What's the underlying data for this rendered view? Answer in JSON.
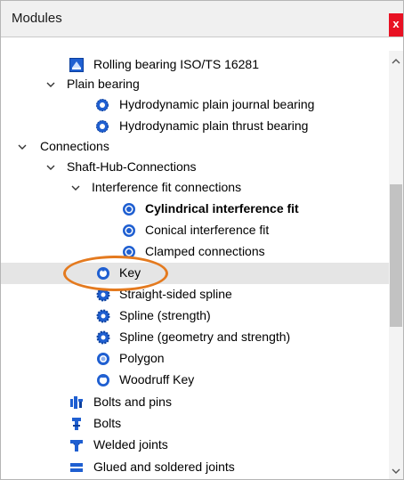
{
  "panel": {
    "title": "Modules",
    "close_label": "x"
  },
  "tree": {
    "items": [
      {
        "label": "Rolling bearing ISO/TS 16281",
        "icon": "rolling-bearing-icon",
        "expanded": null,
        "selected": false,
        "bold": false
      },
      {
        "label": "Plain bearing",
        "icon": null,
        "expanded": true,
        "selected": false,
        "bold": false
      },
      {
        "label": "Hydrodynamic plain journal bearing",
        "icon": "plain-bearing-icon",
        "expanded": null,
        "selected": false,
        "bold": false
      },
      {
        "label": "Hydrodynamic plain thrust bearing",
        "icon": "plain-bearing-icon",
        "expanded": null,
        "selected": false,
        "bold": false
      },
      {
        "label": "Connections",
        "icon": null,
        "expanded": true,
        "selected": false,
        "bold": false
      },
      {
        "label": "Shaft-Hub-Connections",
        "icon": null,
        "expanded": true,
        "selected": false,
        "bold": false
      },
      {
        "label": "Interference fit connections",
        "icon": null,
        "expanded": true,
        "selected": false,
        "bold": false
      },
      {
        "label": "Cylindrical interference fit",
        "icon": "interference-fit-icon",
        "expanded": null,
        "selected": false,
        "bold": true
      },
      {
        "label": "Conical interference fit",
        "icon": "interference-fit-icon",
        "expanded": null,
        "selected": false,
        "bold": false
      },
      {
        "label": "Clamped connections",
        "icon": "interference-fit-icon",
        "expanded": null,
        "selected": false,
        "bold": false
      },
      {
        "label": "Key",
        "icon": "key-icon",
        "expanded": null,
        "selected": true,
        "bold": false
      },
      {
        "label": "Straight-sided spline",
        "icon": "spline-icon",
        "expanded": null,
        "selected": false,
        "bold": false
      },
      {
        "label": "Spline (strength)",
        "icon": "spline-icon",
        "expanded": null,
        "selected": false,
        "bold": false
      },
      {
        "label": "Spline (geometry and strength)",
        "icon": "spline-icon",
        "expanded": null,
        "selected": false,
        "bold": false
      },
      {
        "label": "Polygon",
        "icon": "polygon-icon",
        "expanded": null,
        "selected": false,
        "bold": false
      },
      {
        "label": "Woodruff Key",
        "icon": "woodruff-key-icon",
        "expanded": null,
        "selected": false,
        "bold": false
      },
      {
        "label": "Bolts and pins",
        "icon": "bolts-pins-icon",
        "expanded": null,
        "selected": false,
        "bold": false
      },
      {
        "label": "Bolts",
        "icon": "bolt-icon",
        "expanded": null,
        "selected": false,
        "bold": false
      },
      {
        "label": "Welded joints",
        "icon": "welded-joint-icon",
        "expanded": null,
        "selected": false,
        "bold": false
      },
      {
        "label": "Glued and soldered joints",
        "icon": "glued-joint-icon",
        "expanded": null,
        "selected": false,
        "bold": false
      }
    ]
  },
  "colors": {
    "highlight_ring": "#e47a1f",
    "selection": "#e5e5e5",
    "icon_blue": "#1f5fd1",
    "close": "#e81123"
  }
}
